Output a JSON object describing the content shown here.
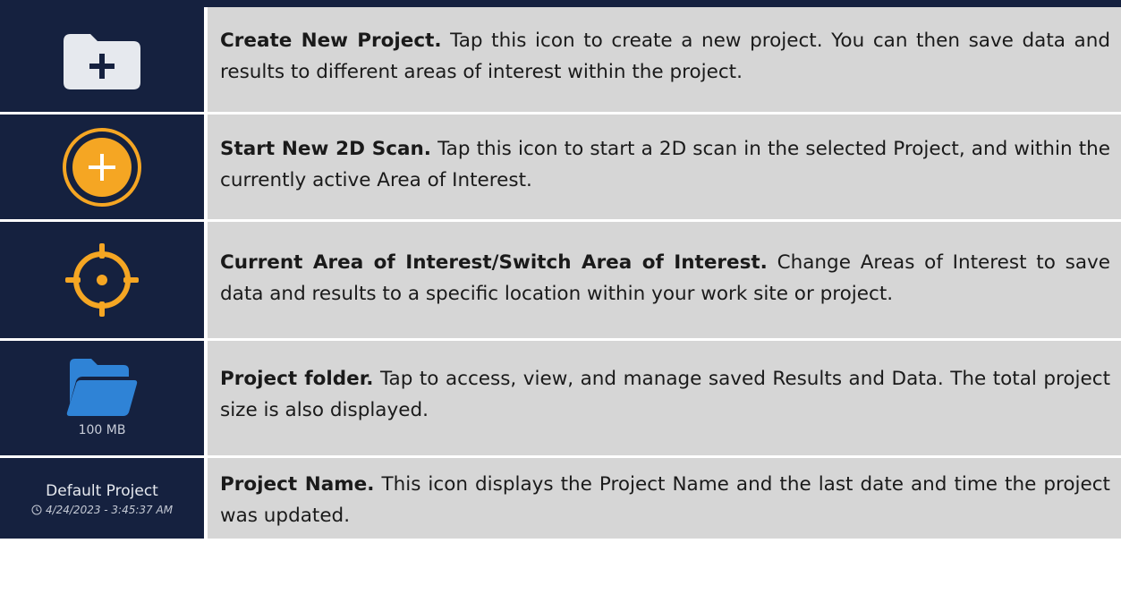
{
  "rows": [
    {
      "icon": "folder-plus-icon",
      "title": "Create New Project.",
      "description": " Tap this icon to create a new project. You can then save data and results to different areas of interest within the project."
    },
    {
      "icon": "plus-circle-icon",
      "title": "Start New 2D Scan.",
      "description": " Tap this icon to start a 2D scan in the selected Project, and within the currently active Area of Interest."
    },
    {
      "icon": "crosshair-icon",
      "title": "Current Area of Interest/Switch Area of Interest.",
      "description": " Change Areas of Interest to save data and results to a specific location within your work site or project."
    },
    {
      "icon": "open-folder-icon",
      "icon_label": "100 MB",
      "title": "Project folder.",
      "description": " Tap to access, view, and manage saved Results and Data. The total project size is also displayed."
    },
    {
      "icon": "clock-icon",
      "project_name": "Default Project",
      "project_date": "4/24/2023 - 3:45:37 AM",
      "title": "Project Name.",
      "description": " This icon displays the Project Name and the last date and time the project was updated."
    }
  ],
  "colors": {
    "icon_bg": "#15213f",
    "text_bg": "#d6d6d6",
    "orange": "#f5a623",
    "folder_blue": "#2f83d6"
  }
}
